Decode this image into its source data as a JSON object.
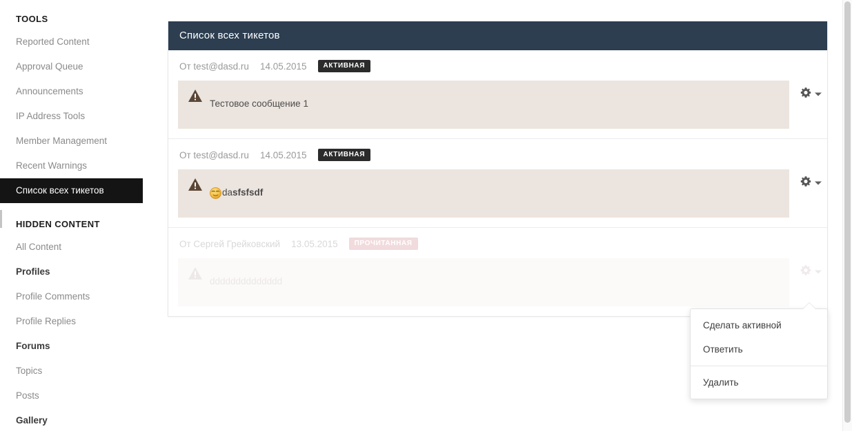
{
  "sidebar": {
    "sections": [
      {
        "heading": "TOOLS",
        "items": [
          {
            "label": "Reported Content",
            "active": false,
            "subhead": false
          },
          {
            "label": "Approval Queue",
            "active": false,
            "subhead": false
          },
          {
            "label": "Announcements",
            "active": false,
            "subhead": false
          },
          {
            "label": "IP Address Tools",
            "active": false,
            "subhead": false
          },
          {
            "label": "Member Management",
            "active": false,
            "subhead": false
          },
          {
            "label": "Recent Warnings",
            "active": false,
            "subhead": false
          },
          {
            "label": "Список всех тикетов",
            "active": true,
            "subhead": false
          }
        ]
      },
      {
        "heading": "HIDDEN CONTENT",
        "items": [
          {
            "label": "All Content",
            "active": false,
            "subhead": false
          },
          {
            "label": "Profiles",
            "active": false,
            "subhead": true
          },
          {
            "label": "Profile Comments",
            "active": false,
            "subhead": false
          },
          {
            "label": "Profile Replies",
            "active": false,
            "subhead": false
          },
          {
            "label": "Forums",
            "active": false,
            "subhead": true
          },
          {
            "label": "Topics",
            "active": false,
            "subhead": false
          },
          {
            "label": "Posts",
            "active": false,
            "subhead": false
          },
          {
            "label": "Gallery",
            "active": false,
            "subhead": true
          }
        ]
      }
    ]
  },
  "panel": {
    "title": "Список всех тикетов",
    "header_bg": "#2c3e50"
  },
  "tickets": [
    {
      "from_prefix": "От",
      "from": "test@dasd.ru",
      "date": "14.05.2015",
      "status_label": "АКТИВНАЯ",
      "status_kind": "active",
      "status_color": "#2b2b2b",
      "body_plain": "Тестовое сообщение 1",
      "body_bold": "",
      "has_emoji": false,
      "emoji_name": "rolling-eyes-smiley",
      "dimmed": false,
      "gear_icon": "gear-icon",
      "caret_icon": "caret-down-icon"
    },
    {
      "from_prefix": "От",
      "from": "test@dasd.ru",
      "date": "14.05.2015",
      "status_label": "АКТИВНАЯ",
      "status_kind": "active",
      "status_color": "#2b2b2b",
      "body_plain": "da",
      "body_bold": "sfsfsdf",
      "has_emoji": true,
      "emoji_name": "rolling-eyes-smiley",
      "dimmed": false,
      "gear_icon": "gear-icon",
      "caret_icon": "caret-down-icon"
    },
    {
      "from_prefix": "От",
      "from": "Сергей Грейковский",
      "date": "13.05.2015",
      "status_label": "ПРОЧИТАННАЯ",
      "status_kind": "read",
      "status_color": "#d9a0a6",
      "body_plain": "dddddddddddddd",
      "body_bold": "",
      "has_emoji": false,
      "emoji_name": "",
      "dimmed": true,
      "gear_icon": "gear-icon",
      "caret_icon": "caret-down-icon"
    }
  ],
  "context_menu": {
    "items": [
      {
        "label": "Сделать активной",
        "separator_after": false
      },
      {
        "label": "Ответить",
        "separator_after": true
      },
      {
        "label": "Удалить",
        "separator_after": false
      }
    ]
  }
}
